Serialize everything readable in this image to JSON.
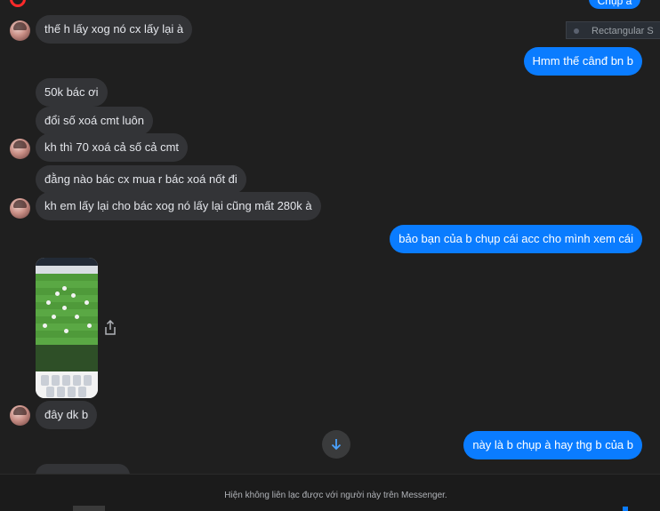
{
  "top_partial_bubble": "Chụp à",
  "tooltip": {
    "label": "Rectangular S",
    "icon": "rectangle-icon"
  },
  "messages": [
    {
      "id": "m1",
      "side": "in",
      "text": "thế h lấy xog nó cx lấy lại à"
    },
    {
      "id": "m2",
      "side": "out",
      "text": "Hmm thế cânđ bn b"
    },
    {
      "id": "m3",
      "side": "in",
      "text": "50k bác ơi"
    },
    {
      "id": "m4",
      "side": "in",
      "text": "đổi số xoá cmt luôn"
    },
    {
      "id": "m5",
      "side": "in",
      "text": "kh thì 70 xoá cả số cả cmt"
    },
    {
      "id": "m6",
      "side": "in",
      "text": "đằng nào bác cx mua r bác xoá nốt đi"
    },
    {
      "id": "m7",
      "side": "in",
      "text": "kh em lấy lại cho bác xog nó lấy lại cũng mất 280k à"
    },
    {
      "id": "m8",
      "side": "out",
      "text": "bảo bạn của b chụp cái acc cho mình xem cái"
    },
    {
      "id": "m9",
      "side": "in",
      "text": "đây dk b"
    },
    {
      "id": "m10",
      "side": "out",
      "text": "này là b chụp à hay thg b của b"
    }
  ],
  "attachment": {
    "type": "image",
    "description_icon": "game-screenshot-thumbnail"
  },
  "footer": {
    "notice": "Hiện không liên lạc được với người này trên Messenger."
  },
  "colors": {
    "background": "#1f1f1f",
    "incoming_bubble": "#333437",
    "outgoing_bubble": "#0a7cff",
    "text_primary": "#e4e6eb",
    "text_secondary": "#b0b3b8"
  }
}
